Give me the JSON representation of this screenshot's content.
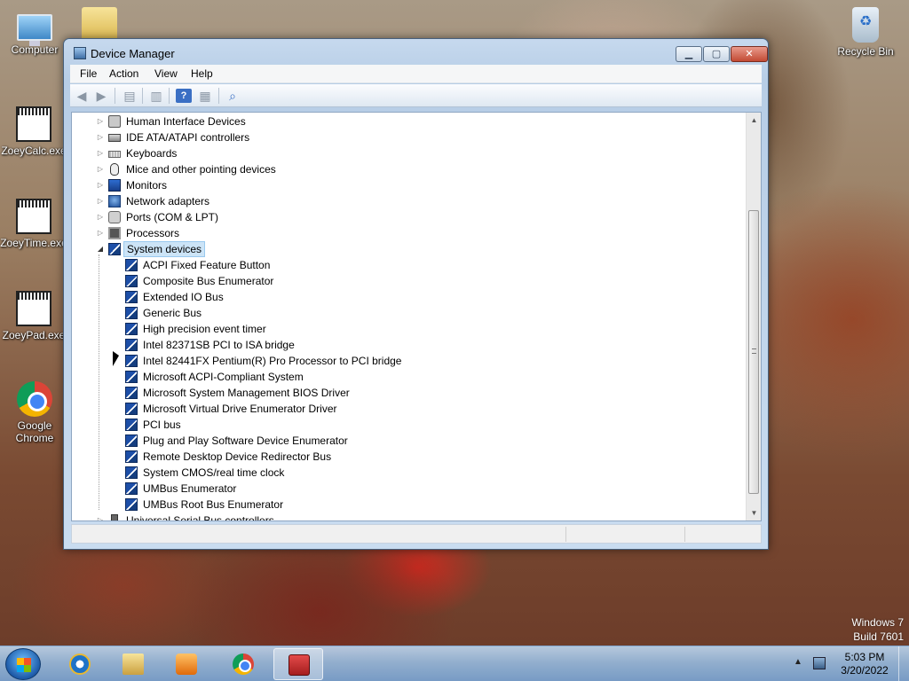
{
  "desktop": {
    "icons": [
      {
        "label": "Computer"
      },
      {
        "label": ""
      },
      {
        "label": "ZoeyCalc.exe"
      },
      {
        "label": "ZoeyTime.exe"
      },
      {
        "label": "ZoeyPad.exe"
      },
      {
        "label": "Google Chrome"
      },
      {
        "label": "Recycle Bin"
      }
    ]
  },
  "window": {
    "title": "Device Manager",
    "controls": {
      "minimize": "▁",
      "maximize": "▢",
      "close": "✕"
    },
    "menu": [
      "File",
      "Action",
      "View",
      "Help"
    ],
    "toolbar_icons": [
      "back-arrow-icon",
      "forward-arrow-icon",
      "properties-icon",
      "details-icon",
      "help-icon",
      "console-tree-icon",
      "scan-hardware-icon"
    ]
  },
  "tree": {
    "categories": [
      {
        "label": "Human Interface Devices",
        "icon": "hid"
      },
      {
        "label": "IDE ATA/ATAPI controllers",
        "icon": "ide"
      },
      {
        "label": "Keyboards",
        "icon": "kbd"
      },
      {
        "label": "Mice and other pointing devices",
        "icon": "mouse"
      },
      {
        "label": "Monitors",
        "icon": "monitor"
      },
      {
        "label": "Network adapters",
        "icon": "net"
      },
      {
        "label": "Ports (COM & LPT)",
        "icon": "ports"
      },
      {
        "label": "Processors",
        "icon": "cpu"
      },
      {
        "label": "System devices",
        "icon": "generic",
        "expanded": true,
        "selected": true
      }
    ],
    "system_devices": [
      "ACPI Fixed Feature Button",
      "Composite Bus Enumerator",
      "Extended IO Bus",
      "Generic Bus",
      "High precision event timer",
      "Intel 82371SB PCI to ISA bridge",
      "Intel 82441FX Pentium(R) Pro Processor to PCI bridge",
      "Microsoft ACPI-Compliant System",
      "Microsoft System Management BIOS Driver",
      "Microsoft Virtual Drive Enumerator Driver",
      "PCI bus",
      "Plug and Play Software Device Enumerator",
      "Remote Desktop Device Redirector Bus",
      "System CMOS/real time clock",
      "UMBus Enumerator",
      "UMBus Root Bus Enumerator"
    ],
    "trailing_category": {
      "label": "Universal Serial Bus controllers",
      "icon": "usb"
    }
  },
  "watermark": {
    "line1": "Windows 7",
    "line2": "Build 7601"
  },
  "taskbar": {
    "apps": [
      {
        "name": "Internet Explorer",
        "glyph": "ie"
      },
      {
        "name": "Windows Explorer",
        "glyph": "explorer"
      },
      {
        "name": "Windows Media Player",
        "glyph": "media"
      },
      {
        "name": "Google Chrome",
        "glyph": "chrome"
      },
      {
        "name": "Device Manager",
        "glyph": "devmgr",
        "active": true
      }
    ],
    "clock": {
      "time": "5:03 PM",
      "date": "3/20/2022"
    }
  }
}
